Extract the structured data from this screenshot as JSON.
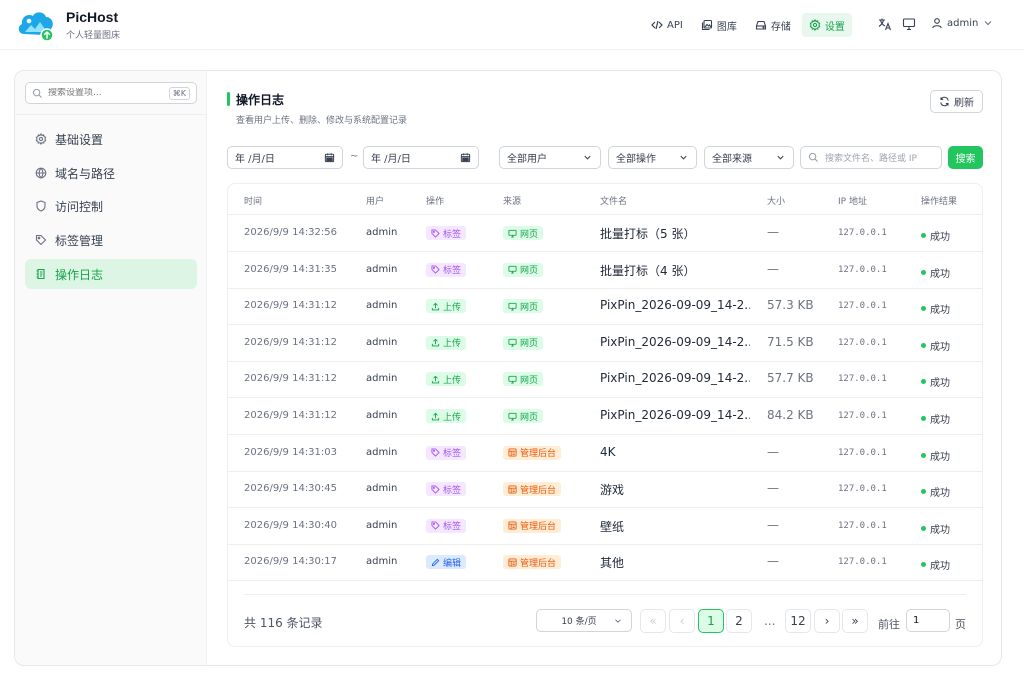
{
  "header": {
    "brand_name": "PicHost",
    "brand_sub": "个人轻量图床",
    "nav": [
      {
        "label": "API",
        "icon": "code-icon"
      },
      {
        "label": "图库",
        "icon": "gallery-icon"
      },
      {
        "label": "存储",
        "icon": "storage-icon"
      },
      {
        "label": "设置",
        "icon": "gear-icon",
        "active": true
      }
    ],
    "user": "admin"
  },
  "sidebar": {
    "search_placeholder": "搜索设置项...",
    "shortcut": "⌘K",
    "items": [
      {
        "label": "基础设置",
        "icon": "gear-icon"
      },
      {
        "label": "域名与路径",
        "icon": "globe-icon"
      },
      {
        "label": "访问控制",
        "icon": "shield-icon"
      },
      {
        "label": "标签管理",
        "icon": "tag-icon"
      },
      {
        "label": "操作日志",
        "icon": "log-icon",
        "active": true
      }
    ]
  },
  "main": {
    "title": "操作日志",
    "description": "查看用户上传、删除、修改与系统配置记录",
    "refresh_label": "刷新",
    "filters": {
      "date_from": "年 /月/日",
      "date_to": "年 /月/日",
      "date_sep": "~",
      "user": "全部用户",
      "action": "全部操作",
      "source": "全部来源",
      "search_placeholder": "搜索文件名、路径或 IP",
      "search_button": "搜索"
    },
    "columns": [
      "时间",
      "用户",
      "操作",
      "来源",
      "文件名",
      "大小",
      "IP 地址",
      "操作结果"
    ],
    "rows": [
      {
        "time": "2026/9/9 14:32:56",
        "user": "admin",
        "action": "标签",
        "action_color": "purple",
        "source": "网页",
        "source_color": "green",
        "file": "批量打标（5 张）",
        "size": "—",
        "ip": "127.0.0.1",
        "result": "成功"
      },
      {
        "time": "2026/9/9 14:31:35",
        "user": "admin",
        "action": "标签",
        "action_color": "purple",
        "source": "网页",
        "source_color": "green",
        "file": "批量打标（4 张）",
        "size": "—",
        "ip": "127.0.0.1",
        "result": "成功"
      },
      {
        "time": "2026/9/9 14:31:12",
        "user": "admin",
        "action": "上传",
        "action_color": "green",
        "source": "网页",
        "source_color": "green",
        "file": "PixPin_2026-09-09_14-2...",
        "size": "57.3 KB",
        "ip": "127.0.0.1",
        "result": "成功"
      },
      {
        "time": "2026/9/9 14:31:12",
        "user": "admin",
        "action": "上传",
        "action_color": "green",
        "source": "网页",
        "source_color": "green",
        "file": "PixPin_2026-09-09_14-2...",
        "size": "71.5 KB",
        "ip": "127.0.0.1",
        "result": "成功"
      },
      {
        "time": "2026/9/9 14:31:12",
        "user": "admin",
        "action": "上传",
        "action_color": "green",
        "source": "网页",
        "source_color": "green",
        "file": "PixPin_2026-09-09_14-2...",
        "size": "57.7 KB",
        "ip": "127.0.0.1",
        "result": "成功"
      },
      {
        "time": "2026/9/9 14:31:12",
        "user": "admin",
        "action": "上传",
        "action_color": "green",
        "source": "网页",
        "source_color": "green",
        "file": "PixPin_2026-09-09_14-2...",
        "size": "84.2 KB",
        "ip": "127.0.0.1",
        "result": "成功"
      },
      {
        "time": "2026/9/9 14:31:03",
        "user": "admin",
        "action": "标签",
        "action_color": "purple",
        "source": "管理后台",
        "source_color": "orange",
        "file": "4K",
        "size": "—",
        "ip": "127.0.0.1",
        "result": "成功"
      },
      {
        "time": "2026/9/9 14:30:45",
        "user": "admin",
        "action": "标签",
        "action_color": "purple",
        "source": "管理后台",
        "source_color": "orange",
        "file": "游戏",
        "size": "—",
        "ip": "127.0.0.1",
        "result": "成功"
      },
      {
        "time": "2026/9/9 14:30:40",
        "user": "admin",
        "action": "标签",
        "action_color": "purple",
        "source": "管理后台",
        "source_color": "orange",
        "file": "壁纸",
        "size": "—",
        "ip": "127.0.0.1",
        "result": "成功"
      },
      {
        "time": "2026/9/9 14:30:17",
        "user": "admin",
        "action": "编辑",
        "action_color": "blue",
        "source": "管理后台",
        "source_color": "orange",
        "file": "其他",
        "size": "—",
        "ip": "127.0.0.1",
        "result": "成功"
      }
    ],
    "pagination": {
      "total_text": "共 116 条记录",
      "page_size": "10 条/页",
      "first": "«",
      "prev": "‹",
      "pages": [
        "1",
        "2",
        "12"
      ],
      "ellipsis": "...",
      "next": "›",
      "last": "»",
      "current": "1",
      "goto_label": "前往",
      "goto_value": "1",
      "goto_unit": "页"
    }
  },
  "colors": {
    "accent": "#22c55e",
    "tag_purple": "#a855f7",
    "tag_green": "#16a34a",
    "tag_blue": "#2563eb",
    "tag_orange": "#ea580c"
  }
}
